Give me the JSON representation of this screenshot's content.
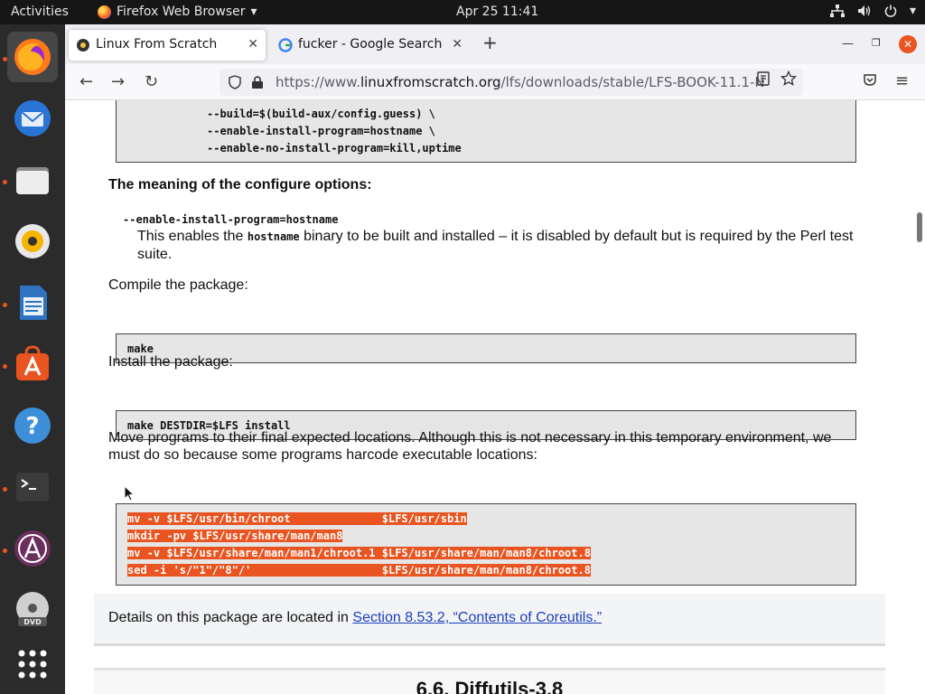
{
  "topbar": {
    "activities": "Activities",
    "app_name": "Firefox Web Browser",
    "clock": "Apr 25  11:41"
  },
  "dock": {
    "items": [
      "firefox",
      "thunderbird",
      "files",
      "rhythmbox",
      "libreoffice-writer",
      "software",
      "help",
      "terminal",
      "app-center",
      "dvd",
      "show-apps"
    ]
  },
  "browser": {
    "tabs": [
      {
        "title": "Linux From Scratch",
        "active": true
      },
      {
        "title": "fucker - Google Search",
        "active": false
      }
    ],
    "url_prefix": "https://www.",
    "url_host": "linuxfromscratch.org",
    "url_path": "/lfs/downloads/stable/LFS-BOOK-11.1-N"
  },
  "page": {
    "config_lines": [
      "--build=$(build-aux/config.guess) \\",
      "--enable-install-program=hostname \\",
      "--enable-no-install-program=kill,uptime"
    ],
    "meaning_heading": "The meaning of the configure options:",
    "option_term": "--enable-install-program=hostname",
    "option_desc_pre": "This enables the ",
    "option_desc_code": "hostname",
    "option_desc_post": " binary to be built and installed – it is disabled by default but is required by the Perl test suite.",
    "compile_text": "Compile the package:",
    "make_cmd": "make",
    "install_text": "Install the package:",
    "install_cmd": "make DESTDIR=$LFS install",
    "move_text": "Move programs to their final expected locations. Although this is not necessary in this temporary environment, we must do so because some programs harcode executable locations:",
    "move_cmds": [
      "mv -v $LFS/usr/bin/chroot              $LFS/usr/sbin",
      "mkdir -pv $LFS/usr/share/man/man8",
      "mv -v $LFS/usr/share/man/man1/chroot.1 $LFS/usr/share/man/man8/chroot.8",
      "sed -i 's/\"1\"/\"8\"/'                    $LFS/usr/share/man/man8/chroot.8"
    ],
    "details_pre": "Details on this package are located in ",
    "details_link": "Section 8.53.2, “Contents of Coreutils.”",
    "next_section": "6.6. Diffutils-3.8"
  },
  "colors": {
    "accent": "#e95420",
    "link": "#1d3fbd"
  }
}
